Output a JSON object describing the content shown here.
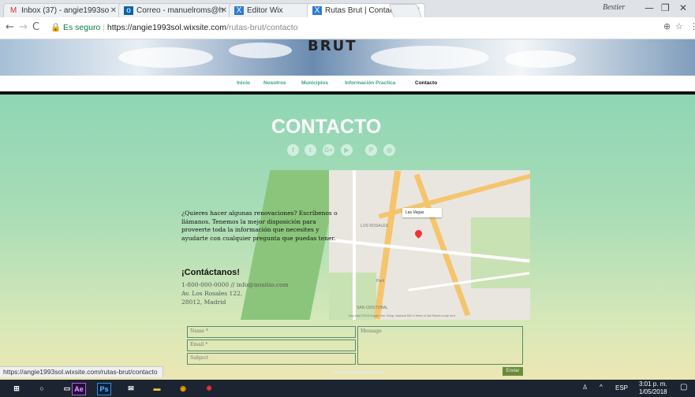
{
  "browser": {
    "tabs": [
      {
        "title": "Inbox (37) - angie1993so",
        "icon": "gmail-icon"
      },
      {
        "title": "Correo - manuelroms@h",
        "icon": "outlook-icon"
      },
      {
        "title": "Editor Wix",
        "icon": "wix-icon"
      },
      {
        "title": "Rutas Brut | Contacto",
        "icon": "wix-icon"
      }
    ],
    "profile_name": "Bestier",
    "secure_label": "Es seguro",
    "url_host": "https://angie1993sol.wixsite.com",
    "url_path": "/rutas-brut/contacto"
  },
  "site": {
    "brand": "BRUT",
    "menu": [
      "Inicio",
      "Nosotros",
      "Municipios",
      "Información Practica",
      "Contacto"
    ],
    "page_title": "CONTACTO",
    "social": [
      "f",
      "t",
      "G+",
      "▶",
      "P",
      "◎"
    ],
    "intro": "¿Quieres hacer algunas renovaciones? Escríbenos o llámanos. Tenemos la mejor disposición para proveerte toda la información que necesites y ayudarte con cualquier pregunta que puedas tener.",
    "contact_heading": "¡Contáctanos!",
    "contact_line1": "1-800-000-0000 // info@misitio.com",
    "contact_line2": "Av. Los Rosales 122,",
    "contact_line3": "28012, Madrid",
    "map": {
      "popup": "Las Vegas",
      "labels": [
        "LOS ROSALES",
        "SAN CRISTOBAL",
        "Park"
      ],
      "attribution": "Map data ©2018 Google, Inst. Geogr. Nacional  500 m     Terms of Use   Report a map error"
    },
    "form": {
      "name_placeholder": "Name *",
      "email_placeholder": "Email *",
      "subject_placeholder": "Subject",
      "message_placeholder": "Message",
      "submit_label": "Enviar"
    }
  },
  "status_url": "https://angie1993sol.wixsite.com/rutas-brut/contacto",
  "taskbar": {
    "apps": [
      "Ae",
      "Ps"
    ],
    "tray_lang": "ESP",
    "time": "3:01 p. m.",
    "date": "1/05/2018"
  }
}
